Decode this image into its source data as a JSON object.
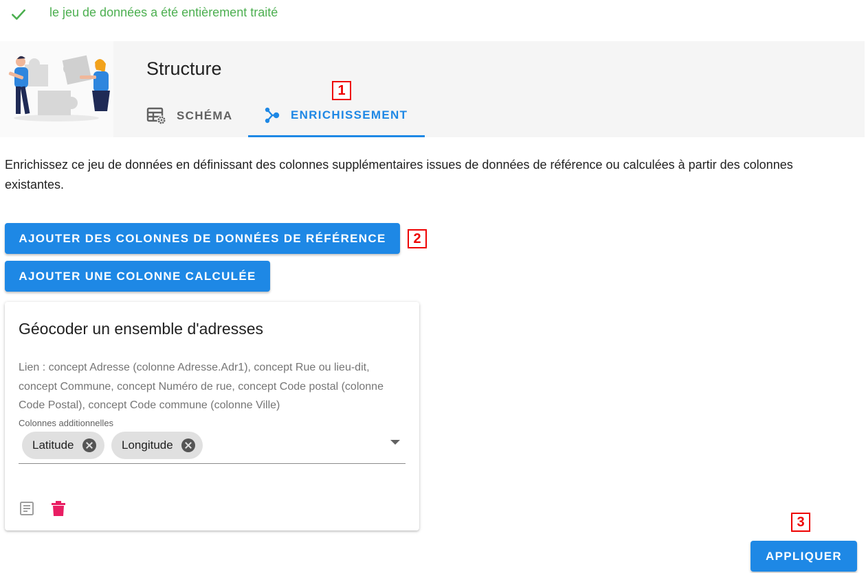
{
  "status": {
    "message": "le jeu de données a été entièrement traité",
    "color": "#4caf50"
  },
  "header": {
    "title": "Structure",
    "tabs": [
      {
        "label": "Schéma",
        "icon": "table-settings-icon",
        "active": false
      },
      {
        "label": "Enrichissement",
        "icon": "graph-connect-icon",
        "active": true
      }
    ]
  },
  "markers": [
    "1",
    "2",
    "3"
  ],
  "intro": "Enrichissez ce jeu de données en définissant des colonnes supplémentaires issues de données de référence ou calculées à partir des colonnes existantes.",
  "buttons": {
    "add_reference": "Ajouter des colonnes de données de référence",
    "add_computed": "Ajouter une colonne calculée",
    "apply": "Appliquer"
  },
  "card": {
    "title": "Géocoder un ensemble d'adresses",
    "description": "Lien : concept Adresse (colonne Adresse.Adr1), concept Rue ou lieu-dit, concept Commune, concept Numéro de rue, concept Code postal (colonne Code Postal), concept Code commune (colonne Ville)",
    "field_label": "Colonnes additionnelles",
    "chips": [
      "Latitude",
      "Longitude"
    ],
    "actions": [
      "document-icon",
      "trash-icon"
    ]
  },
  "colors": {
    "primary": "#1e88e5",
    "success": "#4caf50",
    "danger": "#e91e63",
    "marker": "#ee0000"
  }
}
